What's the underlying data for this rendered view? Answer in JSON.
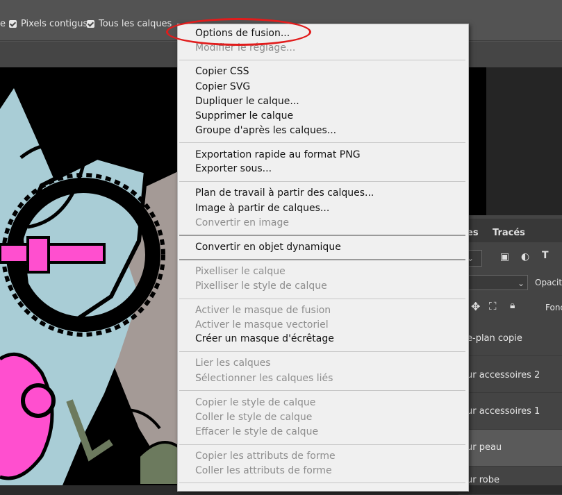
{
  "options_bar": {
    "cut_text": "e",
    "pixels_contigus": "Pixels contigus",
    "tous_les_calques": "Tous les calques"
  },
  "layers_panel": {
    "tab_partial": "es",
    "tab_traces": "Tracés",
    "opacity_label_partial": "Opacit",
    "fill_label_partial": "Fonc",
    "layers": [
      "e-plan copie",
      "ur accessoires 2",
      "ur accessoires 1",
      "ur peau",
      "ur robe"
    ]
  },
  "context_menu": {
    "items": [
      {
        "label": "Options de fusion...",
        "enabled": true
      },
      {
        "label": "Modifier le réglage...",
        "enabled": false
      },
      {
        "label": "Copier CSS",
        "enabled": true
      },
      {
        "label": "Copier SVG",
        "enabled": true
      },
      {
        "label": "Dupliquer le calque...",
        "enabled": true
      },
      {
        "label": "Supprimer le calque",
        "enabled": true
      },
      {
        "label": "Groupe d'après les calques...",
        "enabled": true
      },
      {
        "label": "Exportation rapide au format PNG",
        "enabled": true
      },
      {
        "label": "Exporter sous...",
        "enabled": true
      },
      {
        "label": "Plan de travail à partir des calques...",
        "enabled": true
      },
      {
        "label": "Image à partir de calques...",
        "enabled": true
      },
      {
        "label": "Convertir en image",
        "enabled": false
      },
      {
        "label": "Convertir en objet dynamique",
        "enabled": true
      },
      {
        "label": "Pixelliser le calque",
        "enabled": false
      },
      {
        "label": "Pixelliser le style de calque",
        "enabled": false
      },
      {
        "label": "Activer le masque de fusion",
        "enabled": false
      },
      {
        "label": "Activer le masque vectoriel",
        "enabled": false
      },
      {
        "label": "Créer un masque d'écrêtage",
        "enabled": true
      },
      {
        "label": "Lier les calques",
        "enabled": false
      },
      {
        "label": "Sélectionner les calques liés",
        "enabled": false
      },
      {
        "label": "Copier le style de calque",
        "enabled": false
      },
      {
        "label": "Coller le style de calque",
        "enabled": false
      },
      {
        "label": "Effacer le style de calque",
        "enabled": false
      },
      {
        "label": "Copier les attributs de forme",
        "enabled": false
      },
      {
        "label": "Coller les attributs de forme",
        "enabled": false
      }
    ]
  },
  "annotation_color": "#e11c1c"
}
